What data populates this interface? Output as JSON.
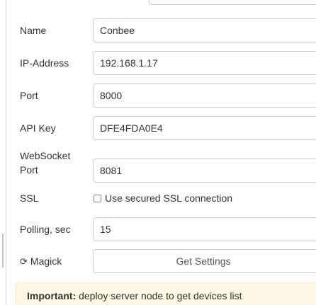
{
  "form": {
    "name": {
      "label": "Name",
      "value": "Conbee"
    },
    "ip": {
      "label": "IP-Address",
      "value": "192.168.1.17"
    },
    "port": {
      "label": "Port",
      "value": "8000"
    },
    "apikey": {
      "label": "API Key",
      "value": "DFE4FDA0E4"
    },
    "websocket": {
      "label_line1": "WebSocket",
      "label_line2": "Port",
      "value": "8081"
    },
    "ssl": {
      "label": "SSL",
      "checkbox_label": "Use secured SSL connection",
      "checked": false
    },
    "polling": {
      "label": "Polling, sec",
      "value": "15"
    },
    "magick": {
      "label": "Magick",
      "icon": "refresh-icon",
      "button_label": "Get Settings"
    }
  },
  "alert": {
    "strong": "Important:",
    "text": " deploy server node to get devices list",
    "bg_color": "#fcf8e3"
  }
}
